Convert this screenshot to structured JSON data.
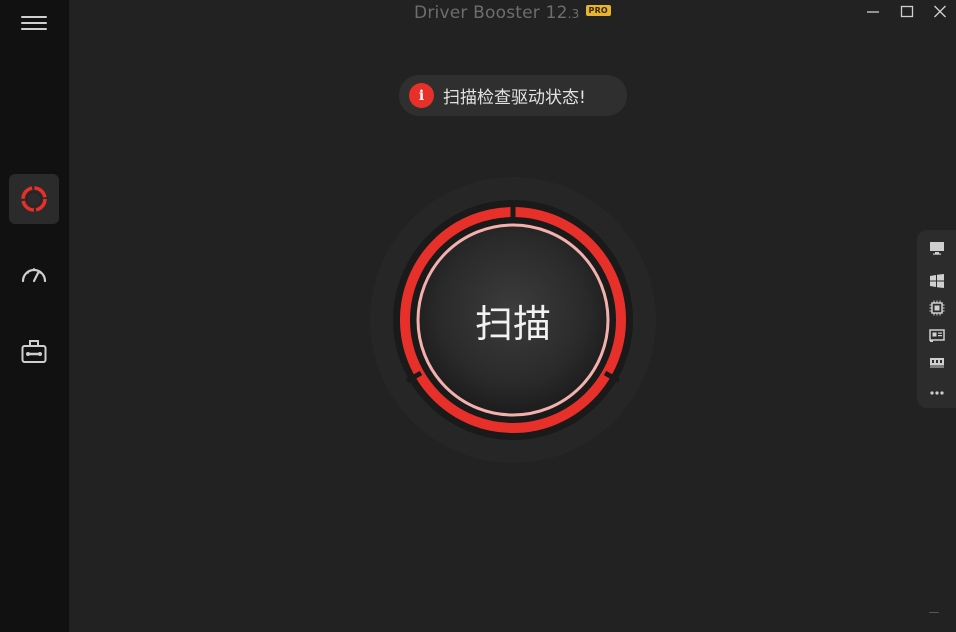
{
  "window": {
    "title": "Driver Booster 12",
    "version_suffix": ".3",
    "badge": "PRO"
  },
  "sidebar": {
    "menu_icon": "hamburger-menu-icon",
    "items": [
      {
        "id": "scan",
        "icon": "scan-ring-icon",
        "active": true
      },
      {
        "id": "speed",
        "icon": "speedometer-icon",
        "active": false
      },
      {
        "id": "tools",
        "icon": "toolbox-icon",
        "active": false
      }
    ]
  },
  "status": {
    "icon": "info-alert-icon",
    "text": "扫描检查驱动状态!"
  },
  "scan_button": {
    "label": "扫描"
  },
  "right_panel": {
    "icons": [
      "monitor-icon",
      "windows-icon",
      "cpu-chip-icon",
      "network-card-icon",
      "memory-icon",
      "more-dots-icon"
    ]
  },
  "colors": {
    "accent": "#e8302a",
    "inner_ring": "#f3b0ad",
    "badge": "#e8b42f",
    "background": "#222222",
    "sidebar": "#111111"
  }
}
